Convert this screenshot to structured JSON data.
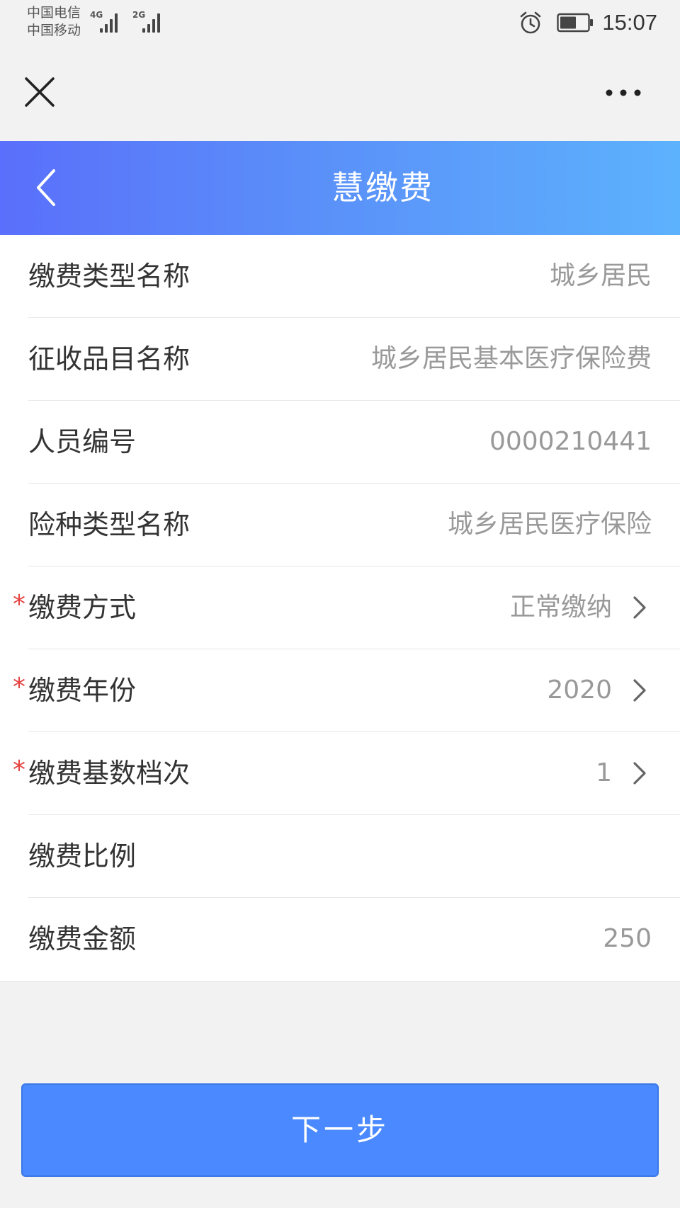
{
  "status_bar": {
    "carrier_1": "中国电信",
    "carrier_2": "中国移动",
    "network_1": "4G",
    "network_2": "2G",
    "time": "15:07",
    "icons": [
      "alarm-icon",
      "battery-icon",
      "signal-icon"
    ]
  },
  "capsule_bar": {
    "close_icon": "close-icon",
    "more_icon": "more-dots-icon"
  },
  "header": {
    "title": "慧缴费",
    "back_icon": "chevron-left-icon"
  },
  "colors": {
    "header_gradient_start": "#5a6ffb",
    "header_gradient_end": "#5db2fd",
    "button": "#4a89ff",
    "required_mark": "#e64340",
    "value_text": "#999999"
  },
  "form": {
    "required_mark": "*",
    "rows": [
      {
        "label": "缴费类型名称",
        "value": "城乡居民"
      },
      {
        "label": "征收品目名称",
        "value": "城乡居民基本医疗保险费"
      },
      {
        "label": "人员编号",
        "value": "0000210441"
      },
      {
        "label": "险种类型名称",
        "value": "城乡居民医疗保险"
      },
      {
        "label": "缴费方式",
        "value": "正常缴纳",
        "required": true,
        "selectable": true
      },
      {
        "label": "缴费年份",
        "value": "2020",
        "required": true,
        "selectable": true
      },
      {
        "label": "缴费基数档次",
        "value": "1",
        "required": true,
        "selectable": true
      },
      {
        "label": "缴费比例",
        "value": ""
      },
      {
        "label": "缴费金额",
        "value": "250"
      }
    ]
  },
  "next_button": {
    "label": "下一步"
  }
}
